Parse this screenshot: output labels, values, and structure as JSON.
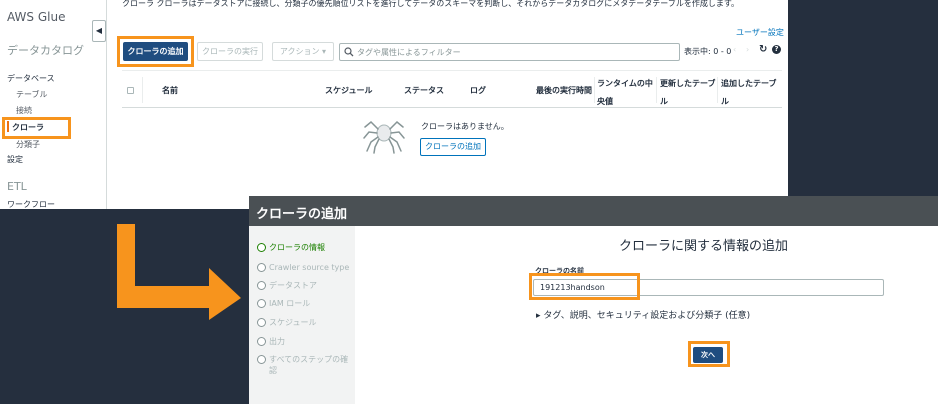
{
  "top_screen": {
    "sidebar": {
      "title": "AWS Glue",
      "catalog_heading": "データカタログ",
      "database": "データベース",
      "table": "テーブル",
      "connections": "接続",
      "crawlers": "クローラ",
      "classifiers": "分類子",
      "settings": "設定",
      "etl_heading": "ETL",
      "workflows": "ワークフロー",
      "collapse_icon": "chevron-left-icon"
    },
    "description": "クローラ  クローラはデータストアに接続し、分類子の優先順位リストを進行してデータのスキーマを判断し、それからデータカタログにメタデータテーブルを作成します。",
    "user_settings": "ユーザー設定",
    "toolbar": {
      "add_crawler": "クローラの追加",
      "run_crawler": "クローラの実行",
      "action": "アクション ▾",
      "filter_placeholder": "タグや属性によるフィルター",
      "showing": "表示中: 0 - 0",
      "prev": "‹",
      "next": "›",
      "refresh_glyph": "↻",
      "help_glyph": "?"
    },
    "table": {
      "columns": [
        "名前",
        "スケジュール",
        "ステータス",
        "ログ",
        "最後の実行時間",
        "ランタイムの中央値",
        "更新したテーブル",
        "追加したテーブル"
      ]
    },
    "empty_state": {
      "message": "クローラはありません。",
      "add_button": "クローラの追加"
    }
  },
  "bottom_screen": {
    "title": "クローラの追加",
    "steps": [
      {
        "label": "クローラの情報",
        "state": "active"
      },
      {
        "label": "Crawler source type",
        "state": "pending"
      },
      {
        "label": "データストア",
        "state": "pending"
      },
      {
        "label": "IAM ロール",
        "state": "pending"
      },
      {
        "label": "スケジュール",
        "state": "pending"
      },
      {
        "label": "出力",
        "state": "pending"
      },
      {
        "label": "すべてのステップの確認",
        "state": "pending"
      }
    ],
    "heading": "クローラに関する情報の追加",
    "name_label": "クローラの名前",
    "name_value": "191213handson",
    "tags_expand": "▸  タグ、説明、セキュリティ設定および分類子 (任意)",
    "next_button": "次へ"
  },
  "colors": {
    "highlight": "#f7941d",
    "primary_button": "#1f4d80",
    "link": "#0073bb",
    "background": "#252f3e",
    "active_step": "#1d8102"
  }
}
